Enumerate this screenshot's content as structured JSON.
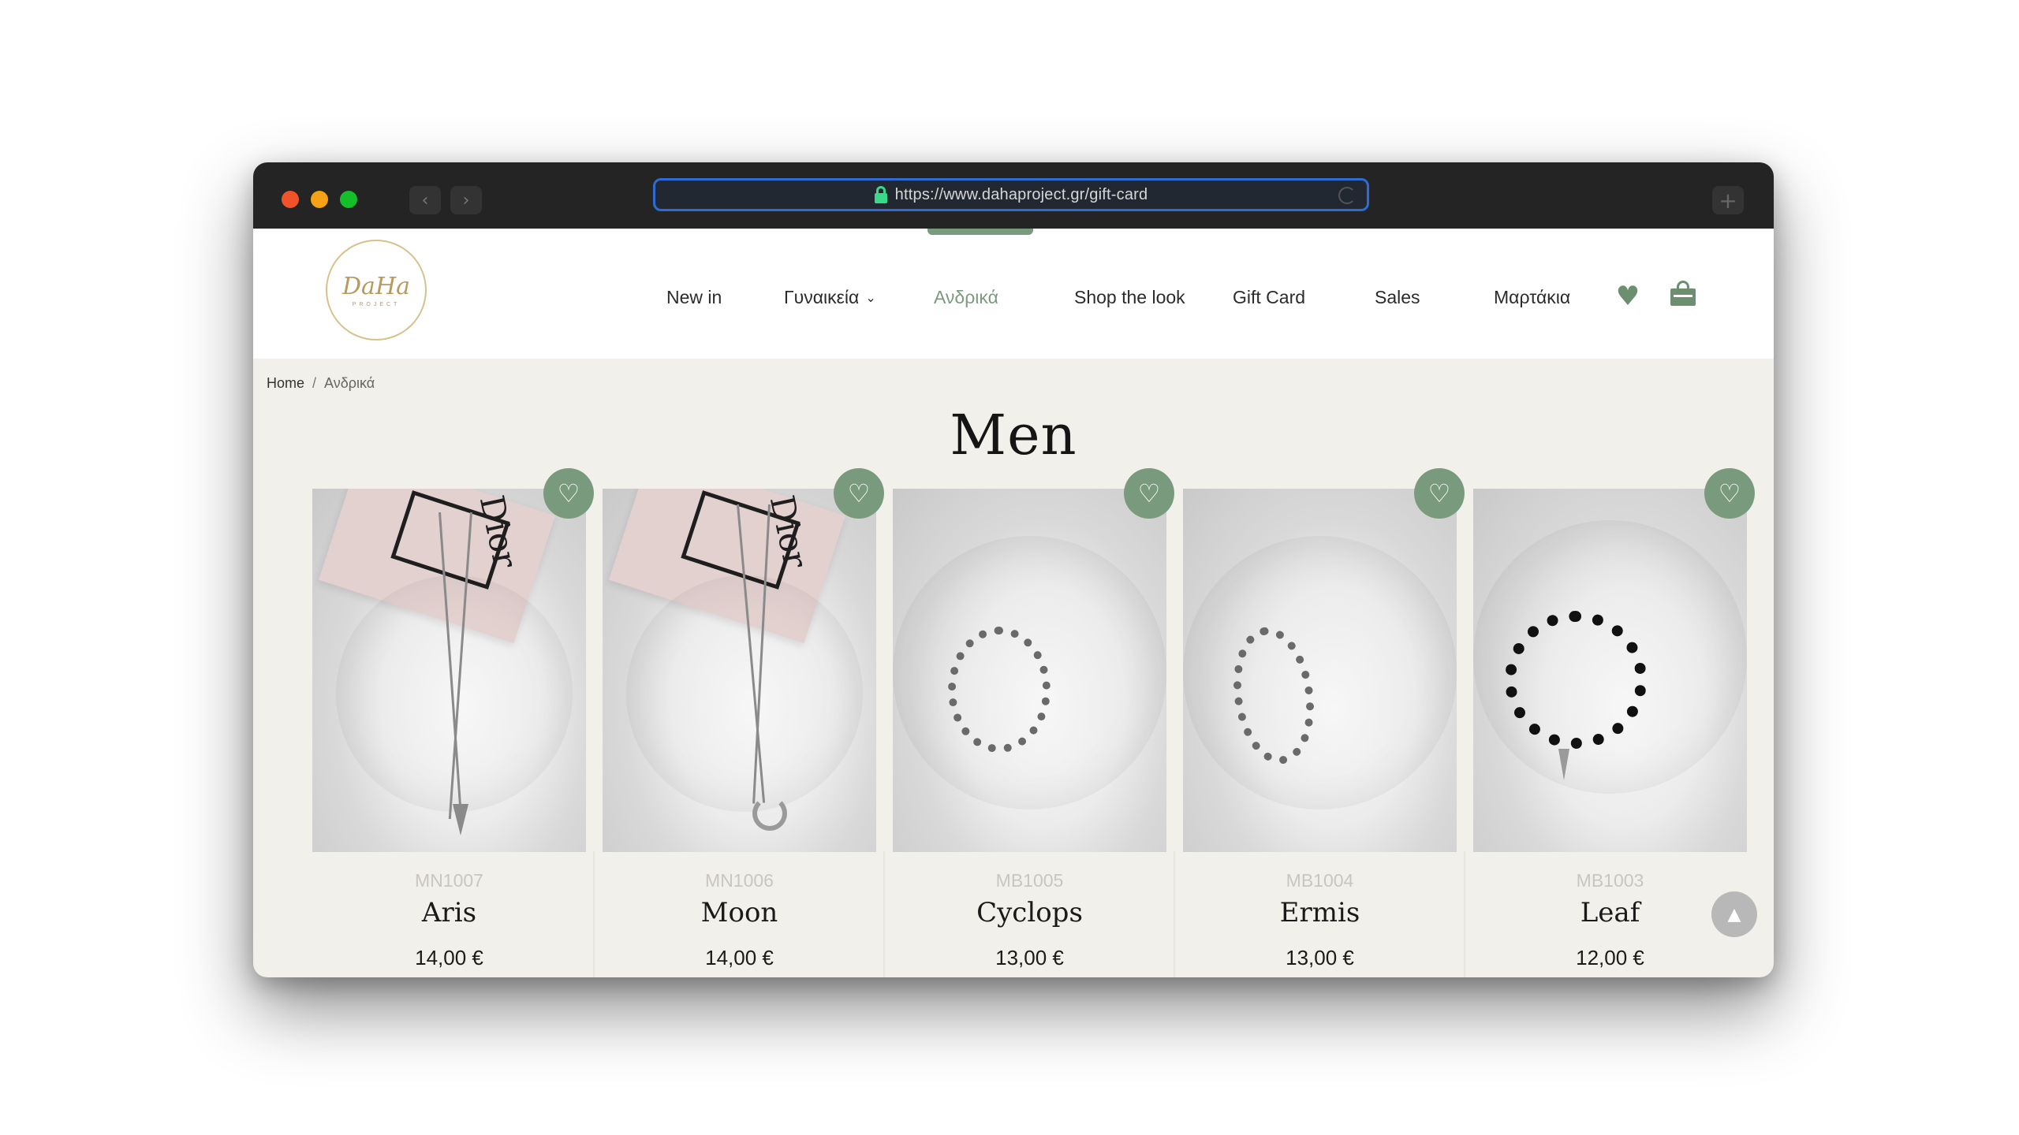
{
  "browser": {
    "url": "https://www.dahaproject.gr/gift-card",
    "back_icon": "chevron-left-icon",
    "forward_icon": "chevron-right-icon",
    "new_tab_icon": "plus-icon"
  },
  "brand": {
    "logo_text": "DaHa",
    "logo_sub": "PROJECT",
    "accent_color": "#7a9a7e"
  },
  "nav": {
    "items": [
      {
        "label": "New in"
      },
      {
        "label": "Γυναικεία"
      },
      {
        "label": "Ανδρικά"
      },
      {
        "label": "Shop the look"
      },
      {
        "label": "Gift Card"
      },
      {
        "label": "Sales"
      },
      {
        "label": "Μαρτάκια"
      }
    ],
    "active": "Ανδρικά",
    "wishlist_icon": "heart-icon",
    "cart_icon": "shopping-bag-icon"
  },
  "breadcrumb": {
    "home": "Home",
    "separator": "/",
    "current": "Ανδρικά"
  },
  "page": {
    "title": "Men"
  },
  "products": [
    {
      "sku": "MN1007",
      "name": "Aris",
      "price": "14,00 €"
    },
    {
      "sku": "MN1006",
      "name": "Moon",
      "price": "14,00 €"
    },
    {
      "sku": "MB1005",
      "name": "Cyclops",
      "price": "13,00 €"
    },
    {
      "sku": "MB1004",
      "name": "Ermis",
      "price": "13,00 €"
    },
    {
      "sku": "MB1003",
      "name": "Leaf",
      "price": "12,00 €"
    }
  ],
  "product_image_text": "Dior",
  "wishlist_button_glyph": "♡",
  "scroll_top_glyph": "▲"
}
